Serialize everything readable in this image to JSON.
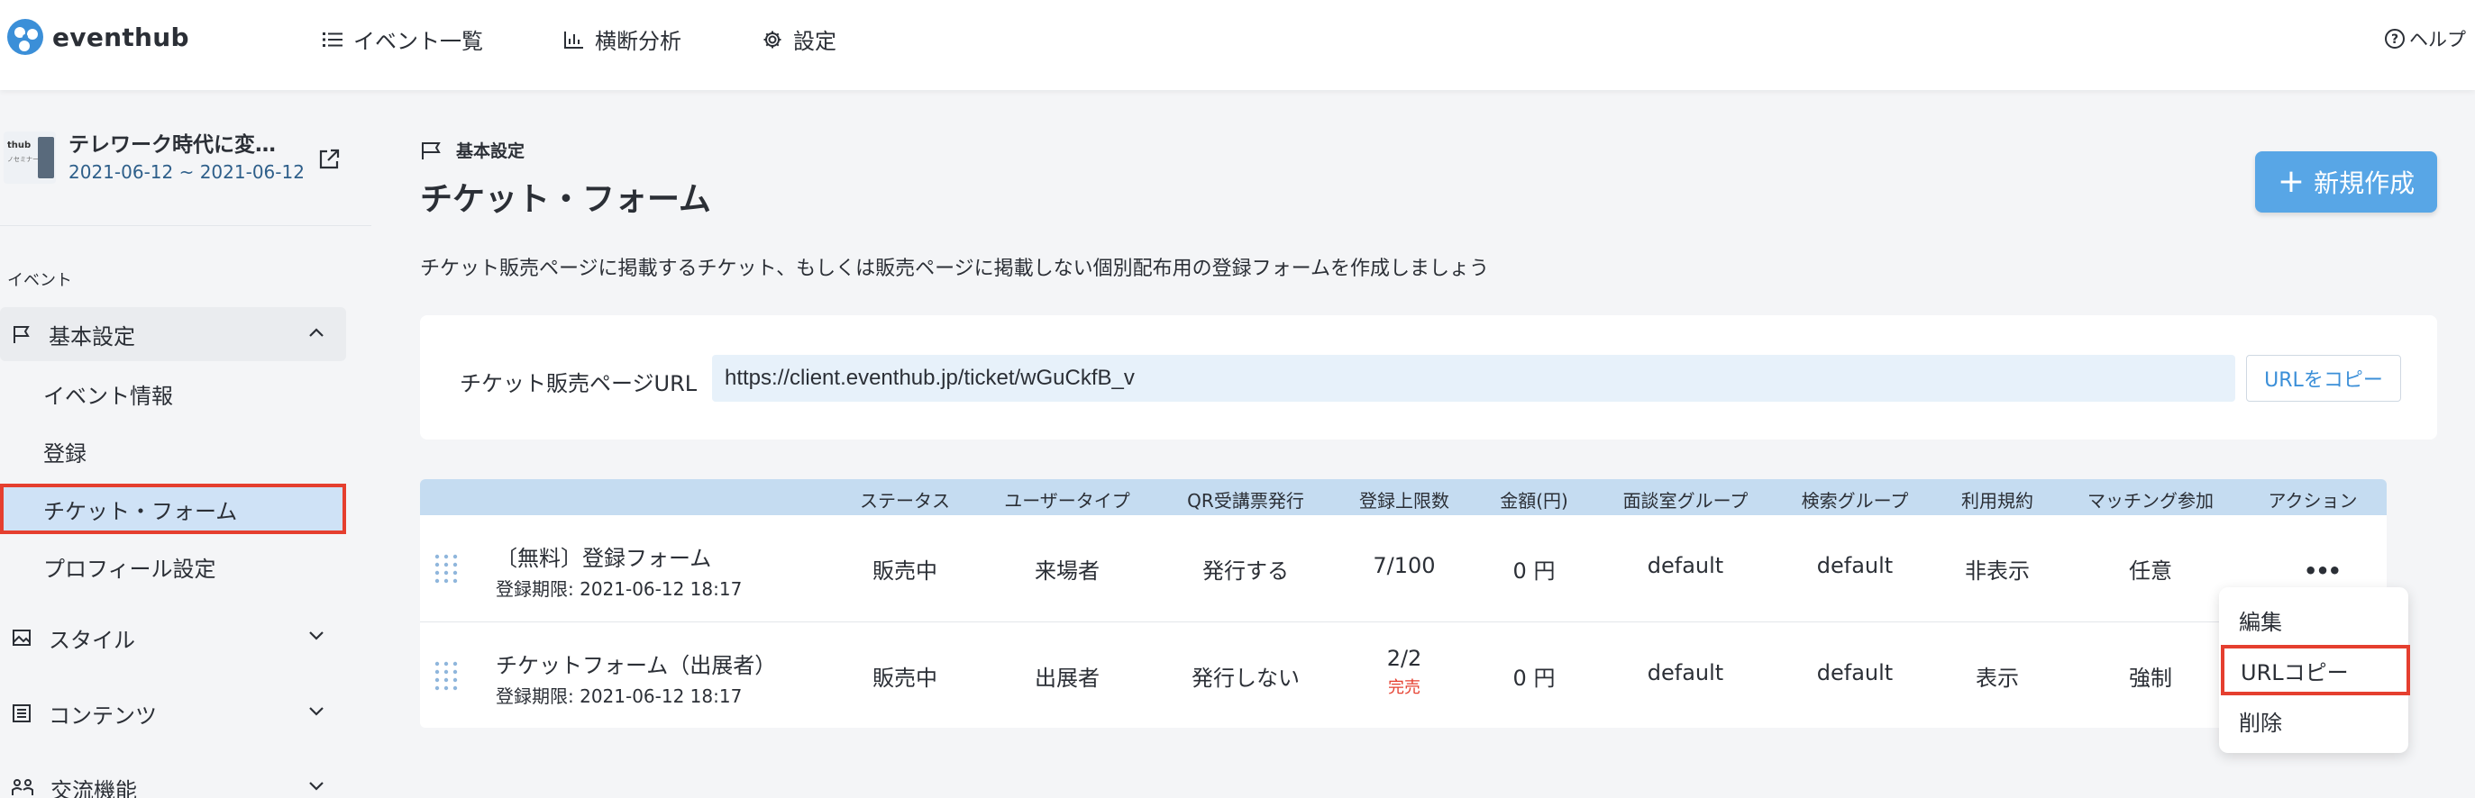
{
  "header": {
    "logo_text": "eventhub",
    "nav": [
      {
        "label": "イベント一覧",
        "icon": "list-icon"
      },
      {
        "label": "横断分析",
        "icon": "bar-chart-icon"
      },
      {
        "label": "設定",
        "icon": "gear-icon"
      }
    ],
    "help_label": "ヘルプ"
  },
  "sidebar": {
    "event": {
      "thumb_title": "thub",
      "thumb_sub": "ノセミナー",
      "title": "テレワーク時代に変…",
      "dates": "2021-06-12 ~ 2021-06-12"
    },
    "section_label": "イベント",
    "groups": [
      {
        "label": "基本設定",
        "icon": "flag-icon",
        "expanded": true
      },
      {
        "label": "スタイル",
        "icon": "image-icon",
        "expanded": false
      },
      {
        "label": "コンテンツ",
        "icon": "list-box-icon",
        "expanded": false
      },
      {
        "label": "交流機能",
        "icon": "people-icon",
        "expanded": false
      }
    ],
    "sub_items": [
      "イベント情報",
      "登録",
      "チケット・フォーム",
      "プロフィール設定"
    ],
    "selected_sub": "チケット・フォーム"
  },
  "main": {
    "breadcrumb": "基本設定",
    "title": "チケット・フォーム",
    "new_button": "新規作成",
    "description": "チケット販売ページに掲載するチケット、もしくは販売ページに掲載しない個別配布用の登録フォームを作成しましょう",
    "url_card": {
      "label": "チケット販売ページURL",
      "value": "https://client.eventhub.jp/ticket/wGuCkfB_v",
      "copy_button": "URLをコピー"
    },
    "table": {
      "headers": [
        "ステータス",
        "ユーザータイプ",
        "QR受講票発行",
        "登録上限数",
        "金額(円)",
        "面談室グループ",
        "検索グループ",
        "利用規約",
        "マッチング参加",
        "アクション"
      ],
      "rows": [
        {
          "name": "〔無料〕登録フォーム",
          "deadline": "登録期限: 2021-06-12 18:17",
          "status": "販売中",
          "user_type": "来場者",
          "qr": "発行する",
          "limit": "7/100",
          "limit_note": "",
          "price": "0 円",
          "room_group": "default",
          "search_group": "default",
          "terms": "非表示",
          "matching": "任意",
          "action": "•••"
        },
        {
          "name": "チケットフォーム（出展者）",
          "deadline": "登録期限: 2021-06-12 18:17",
          "status": "販売中",
          "user_type": "出展者",
          "qr": "発行しない",
          "limit": "2/2",
          "limit_note": "完売",
          "price": "0 円",
          "room_group": "default",
          "search_group": "default",
          "terms": "表示",
          "matching": "強制",
          "action": ""
        }
      ]
    },
    "action_menu": [
      "編集",
      "URLコピー",
      "削除"
    ],
    "highlighted_menu_item": "URLコピー"
  },
  "colors": {
    "accent": "#58a6e6",
    "highlight_border": "#e53f2f",
    "table_header": "#c5dcf1",
    "sold_out": "#e53f2f"
  }
}
